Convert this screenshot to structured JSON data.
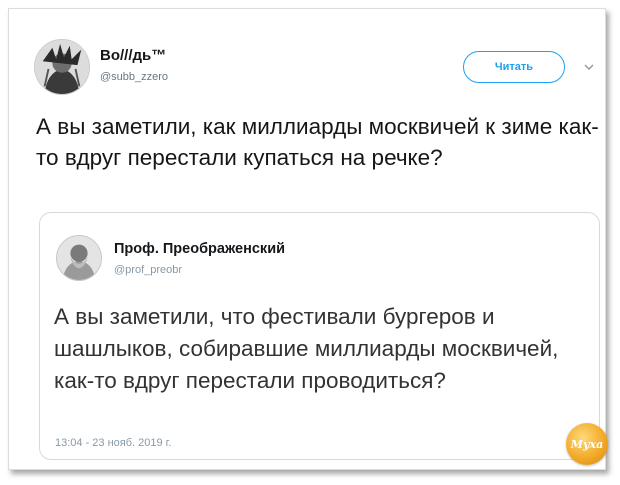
{
  "tweet": {
    "author_name": "Во///дь™",
    "author_handle": "@subb_zzero",
    "follow_label": "Читать",
    "text": "А вы заметили, как миллиарды москвичей к зиме как-то вдруг перестали купаться на речке?",
    "menu_icon": "chevron-down-icon"
  },
  "quoted_tweet": {
    "author_name": "Проф. Преображенский",
    "author_handle": "@prof_preobr",
    "text": "А вы заметили, что фестивали бургеров и шашлыков, собиравшие миллиарды москвичей, как-то вдруг перестали проводиться?",
    "timestamp": "13:04 - 23 нояб. 2019 г."
  },
  "watermark": {
    "text": "Муха"
  },
  "colors": {
    "accent": "#1da1f2",
    "text": "#14171a",
    "secondary": "#657786",
    "border": "#d6dadd"
  }
}
